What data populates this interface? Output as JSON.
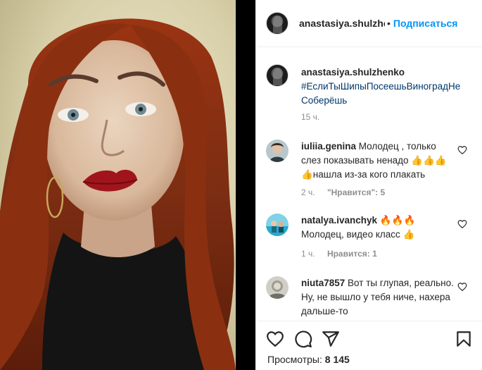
{
  "header": {
    "username": "anastasiya.shulzhenko",
    "separator": "•",
    "follow_label": "Подписаться",
    "more_label": "..."
  },
  "caption": {
    "username": "anastasiya.shulzhenko",
    "hashtag": "#ЕслиТыШипыПосеешьВиноградНеСоберёшь",
    "time": "15 ч."
  },
  "comments": [
    {
      "username": "iuliia.genina",
      "text": "Молодец , только слез показывать ненадо 👍👍👍👍нашла из-за кого плакать",
      "time": "2 ч.",
      "likes": "\"Нравится\": 5"
    },
    {
      "username": "natalya.ivanchyk",
      "text": "🔥🔥🔥 Молодец, видео класс 👍",
      "time": "1 ч.",
      "likes": "Нравится: 1"
    },
    {
      "username": "niuta7857",
      "text": "Вот ты глупая, реально. Ну, не вышло у тебя ниче, нахера дальше-то"
    }
  ],
  "footer": {
    "views_label": "Просмотры:",
    "views_count": "8 145"
  },
  "icons": [
    "heart-icon",
    "comment-icon",
    "share-icon",
    "bookmark-icon"
  ],
  "colors": {
    "link": "#0095f6",
    "hashtag": "#00376b",
    "muted": "#8e8e8e",
    "text": "#262626",
    "border": "#efefef"
  }
}
